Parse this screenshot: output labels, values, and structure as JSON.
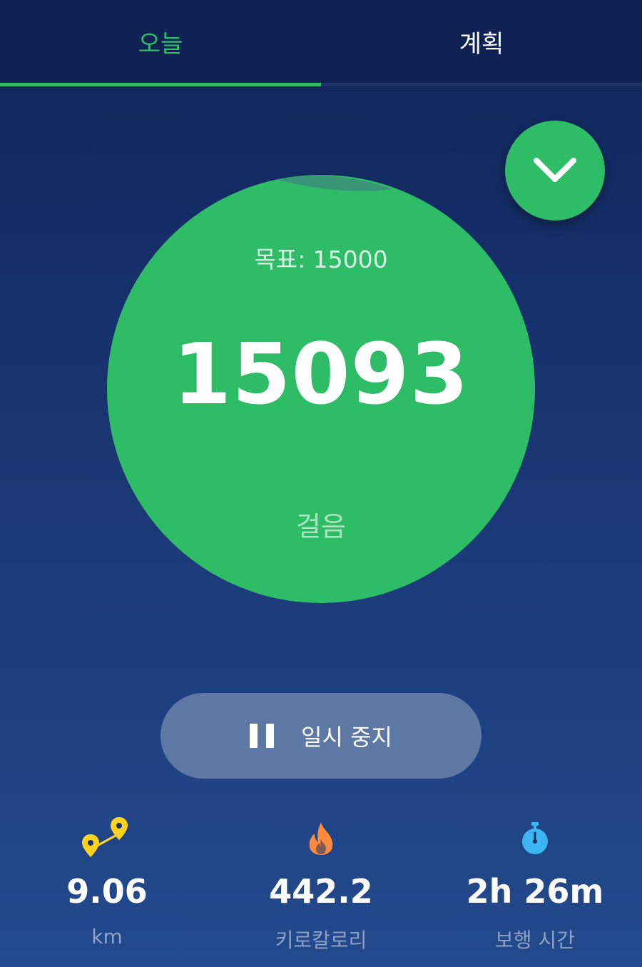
{
  "tabs": {
    "today": "오늘",
    "plan": "계획",
    "active": "today"
  },
  "goal": {
    "text": "목표: 15000"
  },
  "steps": {
    "count": "15093",
    "unit": "걸음"
  },
  "pause_button": {
    "label": "일시 중지"
  },
  "stats": {
    "distance": {
      "value": "9.06",
      "unit": "km",
      "icon": "route-pins-icon"
    },
    "calories": {
      "value": "442.2",
      "unit": "키로칼로리",
      "icon": "flame-icon"
    },
    "time": {
      "value": "2h 26m",
      "unit": "보행 시간",
      "icon": "stopwatch-icon"
    }
  },
  "colors": {
    "accent": "#2ebd66",
    "background": "#16306a",
    "pause_button": "#5e78a6",
    "distance_icon": "#ffd21f",
    "calories_icon": "#ff8a3d",
    "time_icon": "#3cb6f0"
  }
}
